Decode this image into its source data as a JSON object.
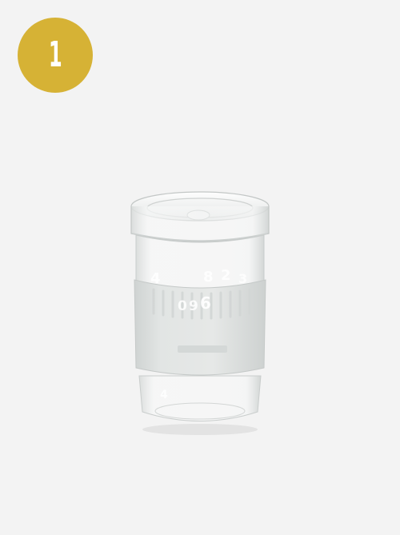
{
  "badge": {
    "number": "1",
    "color": "#d6b235"
  },
  "product": {
    "icon": "glass-cup-image",
    "sleeve_color": "#e0e3e2",
    "background_color": "#f3f3f3"
  }
}
